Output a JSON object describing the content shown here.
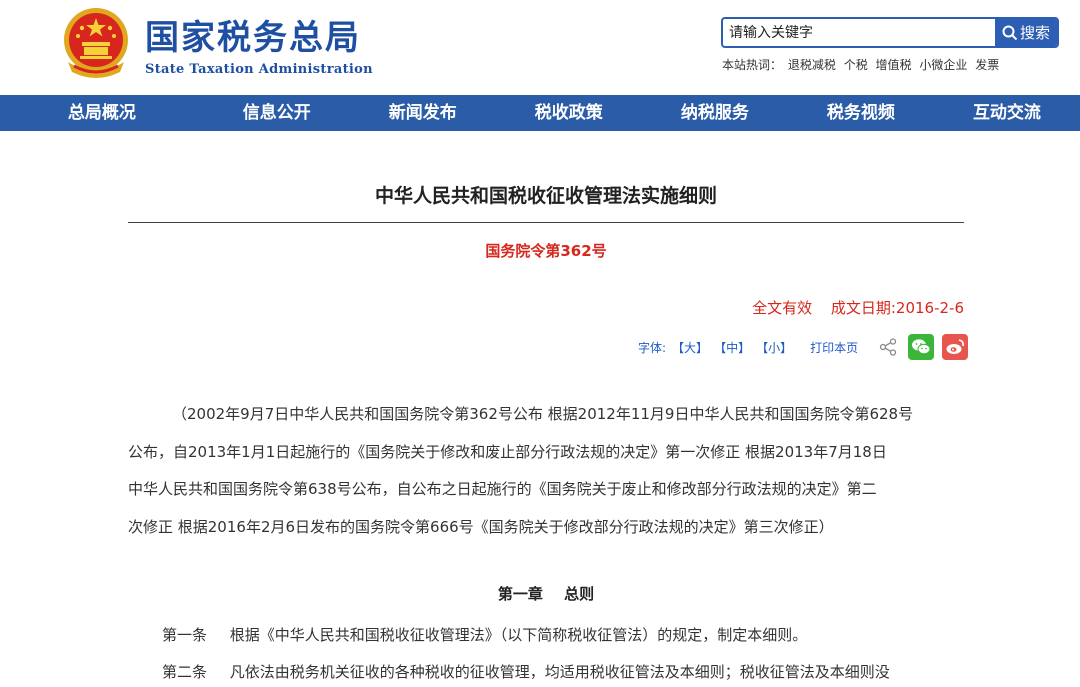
{
  "header": {
    "logo_cn": "国家税务总局",
    "logo_en": "State Taxation Administration",
    "search_placeholder": "请输入关键字",
    "search_button": "搜索",
    "hotwords_label": "本站热词：",
    "hotwords": [
      "退税减税",
      "个税",
      "增值税",
      "小微企业",
      "发票"
    ]
  },
  "nav": {
    "items": [
      "总局概况",
      "信息公开",
      "新闻发布",
      "税收政策",
      "纳税服务",
      "税务视频",
      "互动交流"
    ]
  },
  "article": {
    "title": "中华人民共和国税收征收管理法实施细则",
    "decree": "国务院令第362号",
    "status": "全文有效",
    "date": "成文日期:2016-2-6",
    "tools": {
      "font_label": "字体:",
      "large": "【大】",
      "medium": "【中】",
      "small": "【小】",
      "print": "打印本页"
    },
    "intro_lines": [
      "（2002年9月7日中华人民共和国国务院令第362号公布 根据2012年11月9日中华人民共和国国务院令第628号",
      "公布，自2013年1月1日起施行的《国务院关于修改和废止部分行政法规的决定》第一次修正 根据2013年7月18日",
      "中华人民共和国国务院令第638号公布，自公布之日起施行的《国务院关于废止和修改部分行政法规的决定》第二",
      "次修正 根据2016年2月6日发布的国务院令第666号《国务院关于修改部分行政法规的决定》第三次修正）"
    ],
    "chapter_no": "第一章",
    "chapter_title": "总则",
    "articles": [
      {
        "no": "第一条",
        "text": "根据《中华人民共和国税收征收管理法》（以下简称税收征管法）的规定，制定本细则。"
      },
      {
        "no": "第二条",
        "text": "凡依法由税务机关征收的各种税收的征收管理，均适用税收征管法及本细则；税收征管法及本细则没"
      }
    ]
  },
  "colors": {
    "brand_blue": "#1e4fa3",
    "nav_blue": "#2a5ca8",
    "accent_red": "#d7261d",
    "link_blue": "#1f5bc7"
  }
}
